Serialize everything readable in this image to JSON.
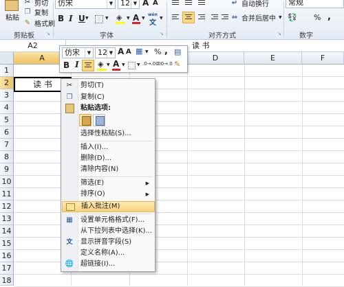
{
  "ribbon": {
    "clipboard": {
      "paste": "粘贴",
      "cut": "剪切",
      "copy": "复制",
      "format_painter": "格式刷",
      "group": "剪贴板"
    },
    "font": {
      "name": "仿宋",
      "size": "12",
      "bold": "B",
      "italic": "I",
      "underline": "U",
      "grow": "A",
      "shrink": "A",
      "font_color": "A",
      "wen": "wén",
      "group": "字体"
    },
    "alignment": {
      "wrap": "自动换行",
      "merge": "合并后居中",
      "group": "对齐方式"
    },
    "number": {
      "format": "常规",
      "group": "数字"
    }
  },
  "formula_bar": {
    "name_box": "A2",
    "formula_text": "读 书"
  },
  "columns": [
    "A",
    "B",
    "C",
    "D",
    "E",
    "F"
  ],
  "rows": [
    "1",
    "2",
    "3",
    "4",
    "5",
    "6",
    "7",
    "8",
    "9",
    "10",
    "11",
    "12",
    "13",
    "14",
    "15",
    "16",
    "17",
    "18"
  ],
  "cell_a2": "读 书",
  "mini_toolbar": {
    "font": "仿宋",
    "size": "12",
    "grow": "A",
    "shrink": "A",
    "percent": "%",
    "comma": ",",
    "bold": "B",
    "italic": "I",
    "font_color": "A",
    "inc_decimal": ".0→.00",
    "dec_decimal": ".00→.0"
  },
  "context_menu": {
    "items": [
      {
        "label": "剪切(T)",
        "icon": "scissors-icon"
      },
      {
        "label": "复制(C)",
        "icon": "copy-icon"
      },
      {
        "label": "粘贴选项:",
        "icon": "paste-icon"
      },
      {
        "label": "选择性粘贴(S)...",
        "icon": ""
      },
      {
        "label": "插入(I)...",
        "icon": ""
      },
      {
        "label": "删除(D)...",
        "icon": ""
      },
      {
        "label": "清除内容(N)",
        "icon": ""
      },
      {
        "label": "筛选(E)",
        "icon": "",
        "submenu": true
      },
      {
        "label": "排序(O)",
        "icon": "",
        "submenu": true
      },
      {
        "label": "插入批注(M)",
        "icon": "comment-icon",
        "highlight": true
      },
      {
        "label": "设置单元格格式(F)...",
        "icon": "format-cells-icon"
      },
      {
        "label": "从下拉列表中选择(K)...",
        "icon": ""
      },
      {
        "label": "显示拼音字段(S)",
        "icon": "phonetic-icon"
      },
      {
        "label": "定义名称(A)...",
        "icon": ""
      },
      {
        "label": "超链接(I)...",
        "icon": "hyperlink-icon"
      }
    ]
  },
  "colors": {
    "accent": "#fbd77d",
    "selection_border": "#000000",
    "ribbon_bg": "#e4ebf5"
  }
}
